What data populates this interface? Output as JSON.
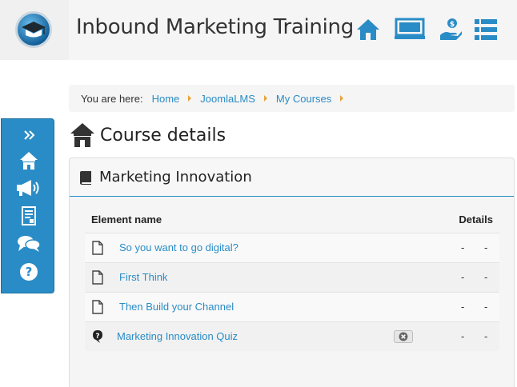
{
  "header": {
    "site_title": "Inbound Marketing Training",
    "icons": [
      "home-icon",
      "presentation-board-icon",
      "hand-coin-icon",
      "list-icon"
    ]
  },
  "breadcrumb": {
    "label": "You are here:",
    "items": [
      "Home",
      "JoomlaLMS",
      "My Courses"
    ]
  },
  "sidebar": {
    "items": [
      "expand-chevrons-icon",
      "home-icon",
      "megaphone-icon",
      "document-icon",
      "chat-bubbles-icon",
      "help-icon"
    ]
  },
  "page": {
    "title": "Course details"
  },
  "course": {
    "name": "Marketing Innovation",
    "columns": {
      "name": "Element name",
      "details": "Details"
    },
    "rows": [
      {
        "name": "So you want to go digital?",
        "type": "document",
        "detail1": "-",
        "detail2": "-"
      },
      {
        "name": "First Think",
        "type": "document",
        "detail1": "-",
        "detail2": "-"
      },
      {
        "name": "Then Build your Channel",
        "type": "document",
        "detail1": "-",
        "detail2": "-"
      },
      {
        "name": "Marketing Innovation Quiz",
        "type": "quiz",
        "detail1": "-",
        "detail2": "-"
      }
    ]
  },
  "colors": {
    "accent": "#2a8cc6",
    "breadcrumb_separator": "#e8a23c"
  }
}
